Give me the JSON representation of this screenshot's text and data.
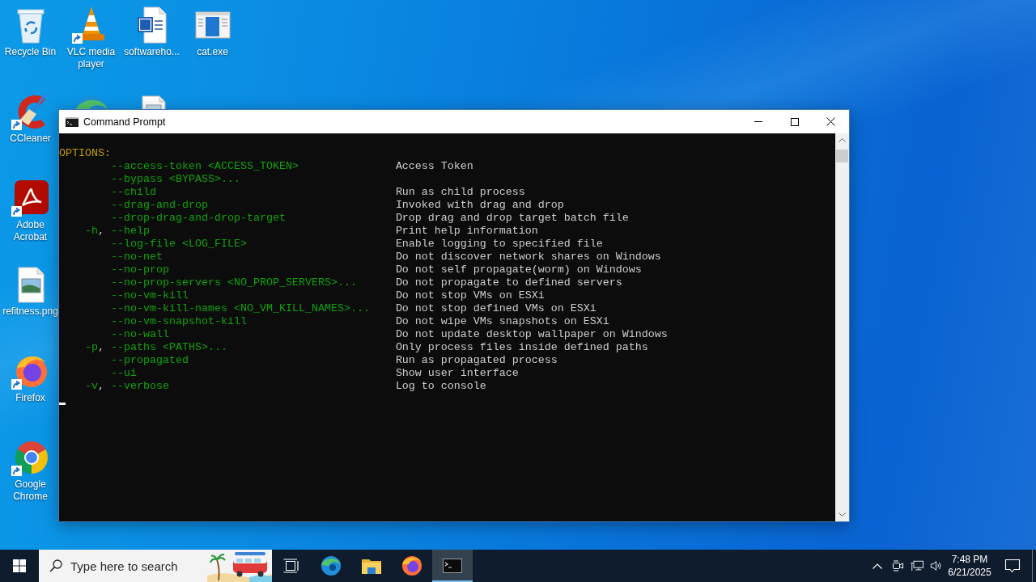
{
  "desktop": {
    "icons": [
      {
        "label": "Recycle Bin"
      },
      {
        "label": "VLC media player"
      },
      {
        "label": "softwareho..."
      },
      {
        "label": "cat.exe"
      },
      {
        "label": "CCleaner"
      },
      {
        "label": "Adobe Acrobat"
      },
      {
        "label": "refitness.png"
      },
      {
        "label": "Firefox"
      },
      {
        "label": "Google Chrome"
      }
    ]
  },
  "window": {
    "title": "Command Prompt",
    "console": {
      "heading": "OPTIONS:",
      "options": [
        {
          "long": "--access-token <ACCESS_TOKEN>",
          "description": "Access Token"
        },
        {
          "long": "--bypass <BYPASS>..."
        },
        {
          "long": "--child",
          "description": "Run as child process"
        },
        {
          "long": "--drag-and-drop",
          "description": "Invoked with drag and drop"
        },
        {
          "long": "--drop-drag-and-drop-target",
          "description": "Drop drag and drop target batch file"
        },
        {
          "short": "-h",
          "separator": ",",
          "long": "--help",
          "description": "Print help information"
        },
        {
          "long": "--log-file <LOG_FILE>",
          "description": "Enable logging to specified file"
        },
        {
          "long": "--no-net",
          "description": "Do not discover network shares on Windows"
        },
        {
          "long": "--no-prop",
          "description": "Do not self propagate(worm) on Windows"
        },
        {
          "long": "--no-prop-servers <NO_PROP_SERVERS>...",
          "description": "Do not propagate to defined servers"
        },
        {
          "long": "--no-vm-kill",
          "description": "Do not stop VMs on ESXi"
        },
        {
          "long": "--no-vm-kill-names <NO_VM_KILL_NAMES>...",
          "description": "Do not stop defined VMs on ESXi"
        },
        {
          "long": "--no-vm-snapshot-kill",
          "description": "Do not wipe VMs snapshots on ESXi"
        },
        {
          "long": "--no-wall",
          "description": "Do not update desktop wallpaper on Windows"
        },
        {
          "short": "-p",
          "separator": ",",
          "long": "--paths <PATHS>...",
          "description": "Only process files inside defined paths"
        },
        {
          "long": "--propagated",
          "description": "Run as propagated process"
        },
        {
          "long": "--ui",
          "description": "Show user interface"
        },
        {
          "short": "-v",
          "separator": ",",
          "long": "--verbose",
          "description": "Log to console"
        }
      ]
    }
  },
  "taskbar": {
    "search": {
      "placeholder": "Type here to search"
    },
    "apps": [
      {
        "selected": false
      },
      {
        "selected": false
      },
      {
        "selected": false
      },
      {
        "selected": true
      }
    ],
    "clock": {
      "time": "7:48 PM",
      "date": "6/21/2025"
    }
  }
}
